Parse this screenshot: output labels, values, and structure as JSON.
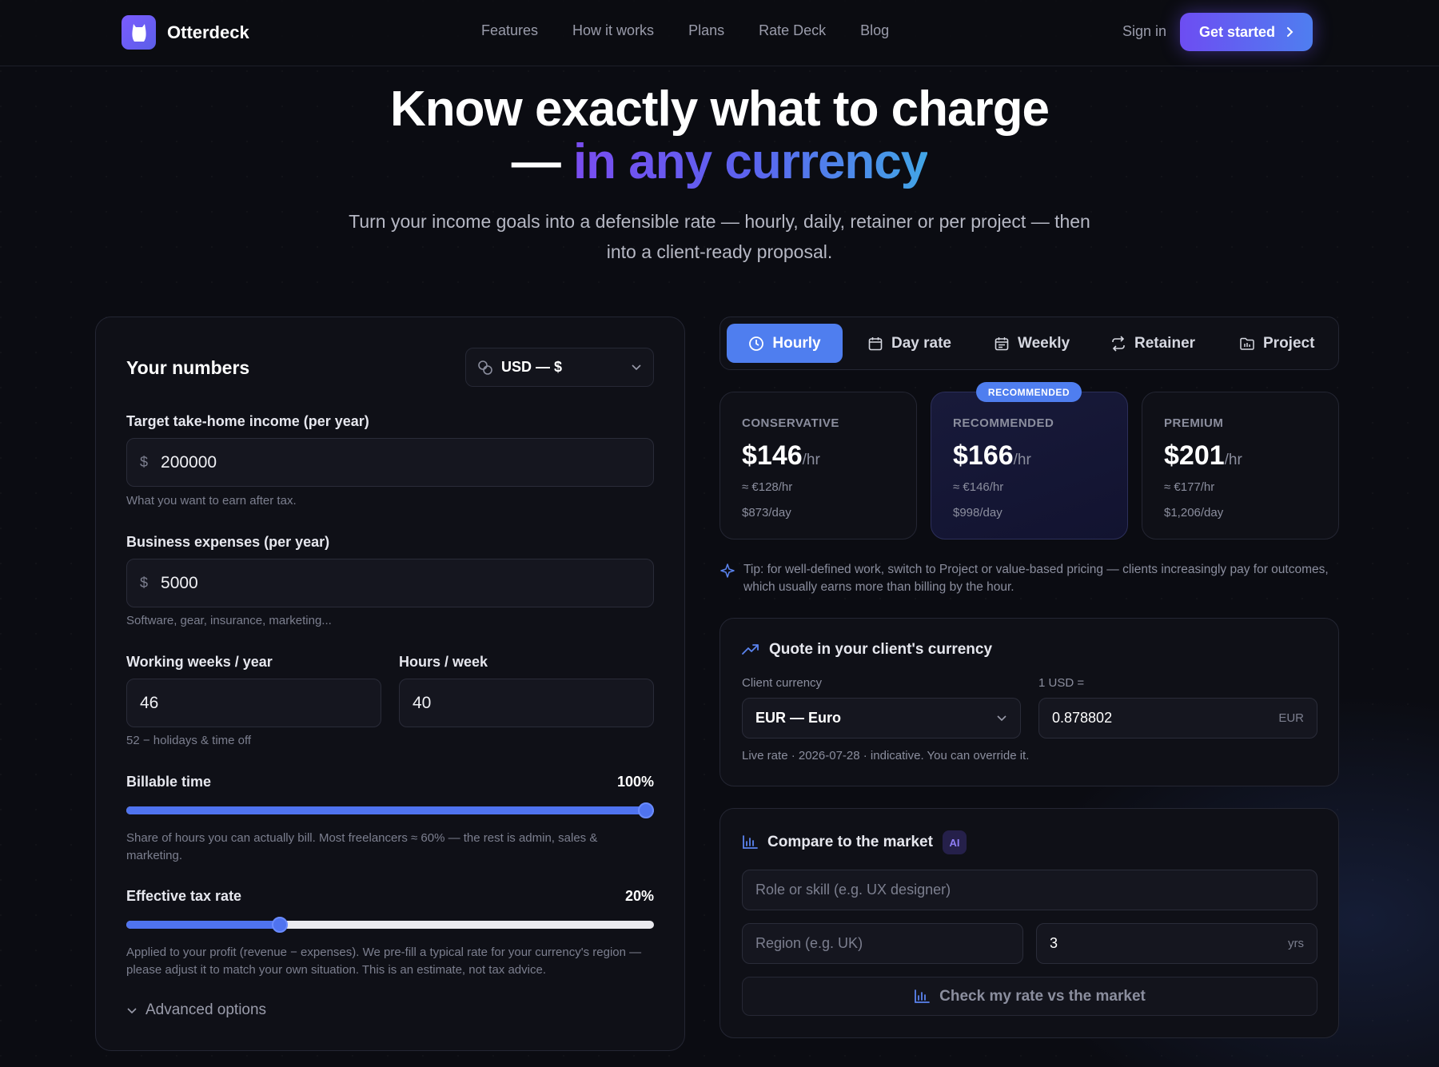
{
  "nav": {
    "brand": "Otterdeck",
    "links": [
      "Features",
      "How it works",
      "Plans",
      "Rate Deck",
      "Blog"
    ],
    "sign_in": "Sign in",
    "cta": "Get started"
  },
  "hero": {
    "title_line1": "Know exactly what to charge",
    "title_dash": "— ",
    "title_highlight": "in any currency",
    "subtitle": "Turn your income goals into a defensible rate — hourly, daily, retainer or per project — then into a client-ready proposal."
  },
  "numbers": {
    "title": "Your numbers",
    "currency": "USD — $",
    "income_label": "Target take-home income (per year)",
    "income_prefix": "$",
    "income_value": "200000",
    "income_help": "What you want to earn after tax.",
    "expenses_label": "Business expenses (per year)",
    "expenses_prefix": "$",
    "expenses_value": "5000",
    "expenses_help": "Software, gear, insurance, marketing...",
    "weeks_label": "Working weeks / year",
    "weeks_value": "46",
    "hours_label": "Hours / week",
    "hours_value": "40",
    "weeks_help": "52 − holidays & time off",
    "billable_label": "Billable time",
    "billable_value": "100%",
    "billable_fraction": 1.0,
    "billable_help": "Share of hours you can actually bill. Most freelancers ≈ 60% — the rest is admin, sales & marketing.",
    "tax_label": "Effective tax rate",
    "tax_value": "20%",
    "tax_fraction": 0.2913,
    "tax_help": "Applied to your profit (revenue − expenses). We pre-fill a typical rate for your currency's region — please adjust it to match your own situation. This is an estimate, not tax advice.",
    "advanced": "Advanced options"
  },
  "tabs": [
    "Hourly",
    "Day rate",
    "Weekly",
    "Retainer",
    "Project"
  ],
  "rates": {
    "badge": "RECOMMENDED",
    "cards": [
      {
        "label": "CONSERVATIVE",
        "price": "$146",
        "unit": "/hr",
        "converted": "≈ €128/hr",
        "day": "$873/day"
      },
      {
        "label": "RECOMMENDED",
        "price": "$166",
        "unit": "/hr",
        "converted": "≈ €146/hr",
        "day": "$998/day"
      },
      {
        "label": "PREMIUM",
        "price": "$201",
        "unit": "/hr",
        "converted": "≈ €177/hr",
        "day": "$1,206/day"
      }
    ]
  },
  "tip": "Tip: for well-defined work, switch to Project or value-based pricing — clients increasingly pay for outcomes, which usually earns more than billing by the hour.",
  "quote": {
    "title": "Quote in your client's currency",
    "client_currency_label": "Client currency",
    "client_currency": "EUR — Euro",
    "rate_label": "1 USD =",
    "rate_value": "0.878802",
    "rate_suffix": "EUR",
    "note": "Live rate · 2026-07-28 · indicative. You can override it."
  },
  "market": {
    "title": "Compare to the market",
    "ai": "AI",
    "role_placeholder": "Role or skill (e.g. UX designer)",
    "region_placeholder": "Region (e.g. UK)",
    "years_value": "3",
    "years_suffix": "yrs",
    "check_button": "Check my rate vs the market"
  },
  "colors": {
    "accent": "#4f7eef",
    "cta_start": "#6d4df2",
    "cta_end": "#4f7ef0",
    "background": "#0b0c12"
  }
}
